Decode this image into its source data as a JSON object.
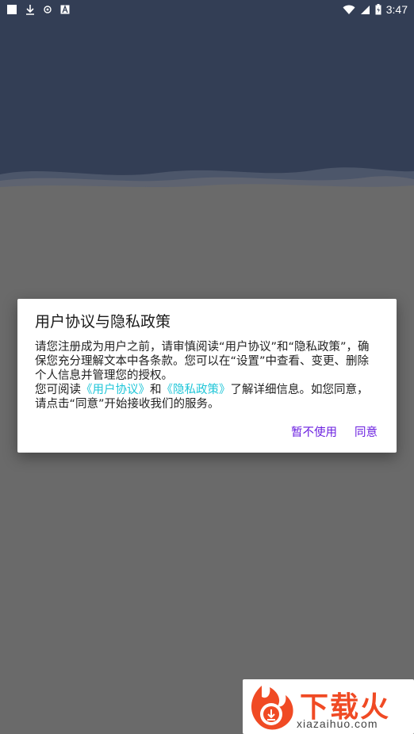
{
  "status_bar": {
    "time": "3:47",
    "icons": [
      "square-icon",
      "download-icon",
      "bug-icon",
      "a-icon",
      "wifi-icon",
      "signal-icon",
      "battery-icon"
    ]
  },
  "dialog": {
    "title": "用户协议与隐私政策",
    "body_line1": "请您注册成为用户之前，请审慎阅读“用户协议”和“隐私政策”，确保您充分理解文本中各条款。您可以在“设置”中查看、变更、删除个人信息并管理您的授权。",
    "body_line2_prefix": "您可阅读",
    "link_user_agreement": "《用户协议》",
    "and_text": "和",
    "link_privacy_policy": "《隐私政策》",
    "body_line2_suffix": "了解详细信息。如您同意，请点击“同意”开始接收我们的服务。",
    "decline_label": "暂不使用",
    "agree_label": "同意"
  },
  "watermark": {
    "brand": "下载火",
    "url": "xiazaihuo.com"
  },
  "colors": {
    "header_bg": "#333e55",
    "scrim_bg": "#6a6a6a",
    "link": "#1fc6d8",
    "action": "#6a1ee0",
    "brand": "#f04a24"
  }
}
